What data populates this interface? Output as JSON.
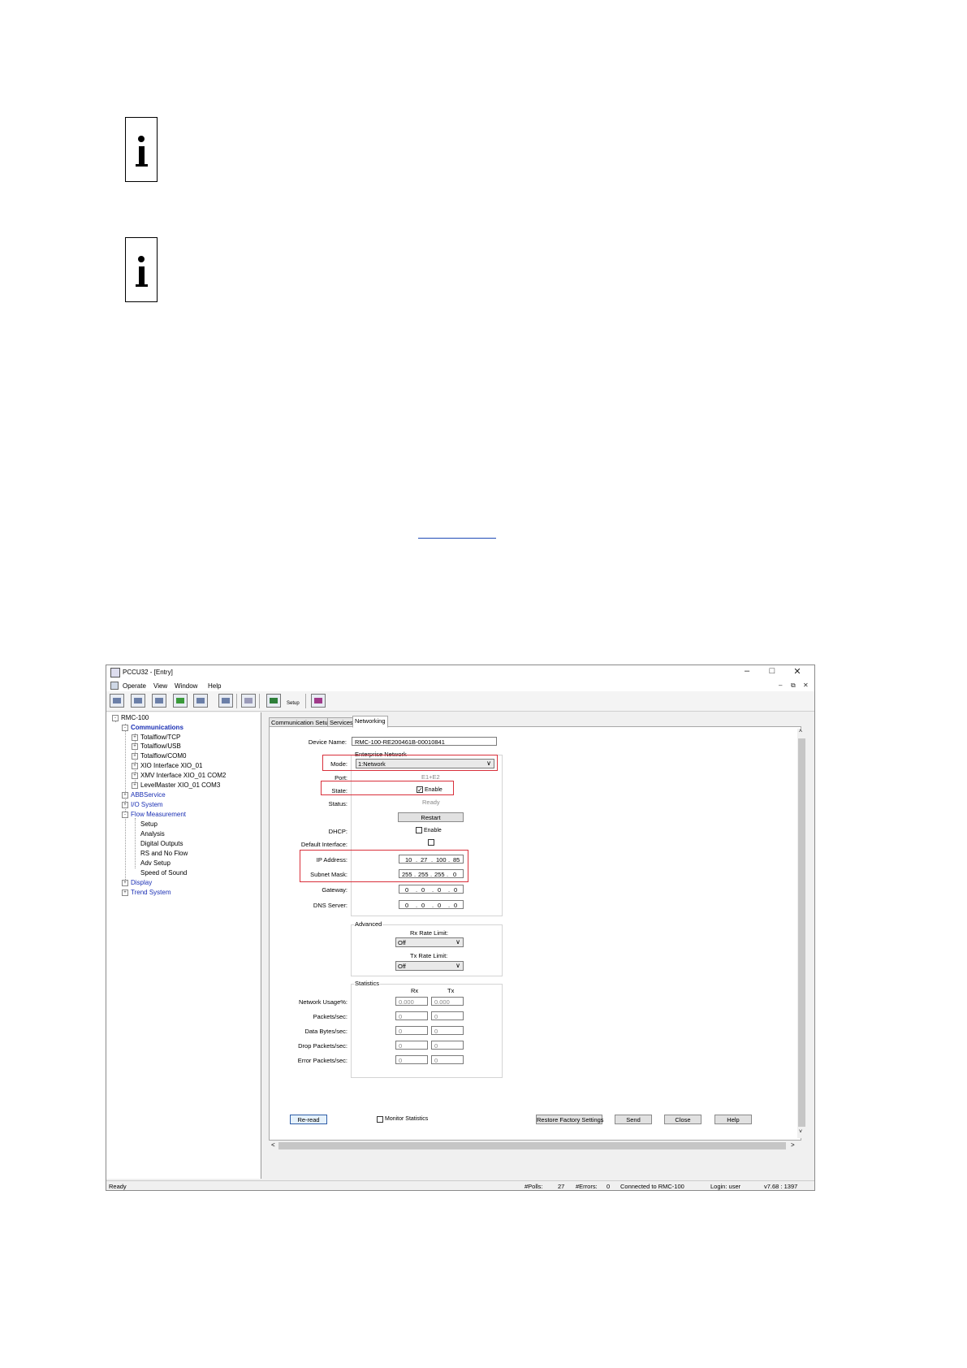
{
  "doc": {
    "note_icons": [
      "info-icon",
      "info-icon"
    ]
  },
  "window": {
    "title": "PCCU32 - [Entry]",
    "controls": {
      "minimize": "–",
      "maximize": "□",
      "close": "✕"
    },
    "mdi_controls": {
      "minimize": "–",
      "restore": "⧉",
      "close": "✕"
    },
    "menu": [
      "Operate",
      "View",
      "Window",
      "Help"
    ],
    "toolbar_setup_label": "Setup"
  },
  "tree": {
    "root": "RMC-100",
    "communications": "Communications",
    "comm_children": [
      "Totalflow/TCP",
      "Totalflow/USB",
      "Totalflow/COM0",
      "XIO Interface XIO_01",
      "XMV Interface XIO_01 COM2",
      "LevelMaster XIO_01 COM3"
    ],
    "abbservice": "ABBService",
    "io_system": "I/O System",
    "flow_measurement": "Flow Measurement",
    "flow_children": [
      "Setup",
      "Analysis",
      "Digital Outputs",
      "RS and No Flow",
      "Adv Setup",
      "Speed of Sound"
    ],
    "display": "Display",
    "trend_system": "Trend System"
  },
  "tabs": [
    "Communication Setup",
    "Services",
    "Networking"
  ],
  "form": {
    "device_name_label": "Device Name:",
    "device_name_value": "RMC-100-RE200461B-00010841",
    "enterprise_network": "Enterprise Network",
    "mode_label": "Mode:",
    "mode_value": "1:Network",
    "port_label": "Port:",
    "port_value": "E1+E2",
    "state_label": "State:",
    "state_check": "✓",
    "state_enable": "Enable",
    "status_label": "Status:",
    "status_value": "Ready",
    "restart": "Restart",
    "dhcp_label": "DHCP:",
    "dhcp_enable": "Enable",
    "default_interface_label": "Default Interface:",
    "ip_label": "IP Address:",
    "ip": [
      "10",
      "27",
      "100",
      "85"
    ],
    "subnet_label": "Subnet Mask:",
    "subnet": [
      "255",
      "255",
      "255",
      "0"
    ],
    "gateway_label": "Gateway:",
    "gateway": [
      "0",
      "0",
      "0",
      "0"
    ],
    "dns_label": "DNS Server:",
    "dns": [
      "0",
      "0",
      "0",
      "0"
    ],
    "ip_separator": ".",
    "advanced": "Advanced",
    "rx_rate_label": "Rx Rate Limit:",
    "rx_rate_value": "Off",
    "tx_rate_label": "Tx Rate Limit:",
    "tx_rate_value": "Off",
    "statistics": "Statistics",
    "rx_col": "Rx",
    "tx_col": "Tx",
    "stats_rows": [
      {
        "label": "Network Usage%:",
        "rx": "0.000",
        "tx": "0.000"
      },
      {
        "label": "Packets/sec:",
        "rx": "0",
        "tx": "0"
      },
      {
        "label": "Data Bytes/sec:",
        "rx": "0",
        "tx": "0"
      },
      {
        "label": "Drop Packets/sec:",
        "rx": "0",
        "tx": "0"
      },
      {
        "label": "Error Packets/sec:",
        "rx": "0",
        "tx": "0"
      }
    ],
    "dropdown_arrow": "∨"
  },
  "buttons": {
    "reread": "Re-read",
    "monitor_statistics": "Monitor Statistics",
    "restore_factory": "Restore Factory Settings",
    "send": "Send",
    "close": "Close",
    "help": "Help"
  },
  "scroll": {
    "up": "˄",
    "down": "˅",
    "left": "<",
    "right": ">"
  },
  "statusbar": {
    "left": "Ready",
    "polls_label": "#Polls:",
    "polls_value": "27",
    "errors_label": "#Errors:",
    "errors_value": "0",
    "connected": "Connected to RMC-100",
    "login": "Login: user",
    "version": "v7.68 : 1397"
  },
  "colors": {
    "highlight": "#d9303b",
    "link": "#1f4bb5",
    "tree_blue": "#1a2fb4"
  }
}
